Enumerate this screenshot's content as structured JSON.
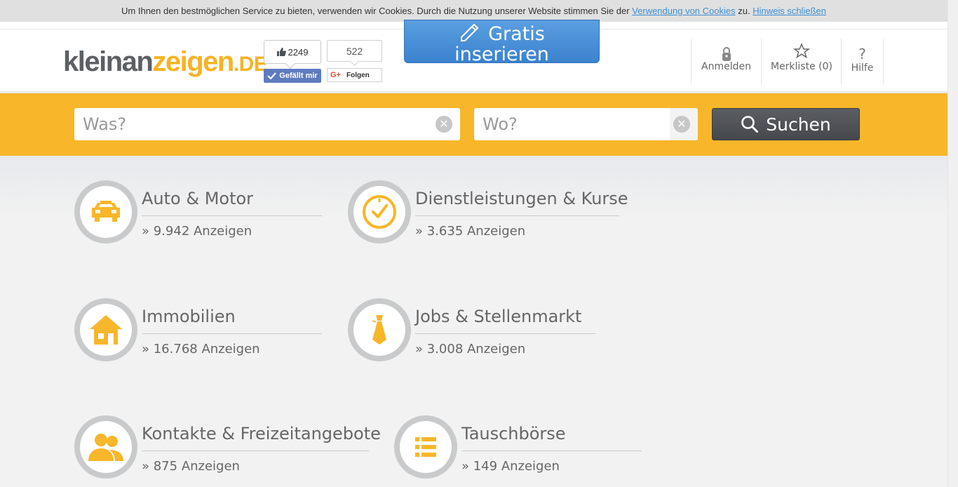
{
  "cookie_bar": {
    "text": "Um Ihnen den bestmöglichen Service zu bieten, verwenden wir Cookies. Durch die Nutzung unserer Website stimmen Sie der",
    "link1": "Verwendung von Cookies",
    "middle": "zu.",
    "link2": "Hinweis schließen"
  },
  "logo": {
    "part1": "kleinan",
    "part2": "zeigen",
    "part3": ".DE"
  },
  "social": {
    "fb_count": "2249",
    "fb_label": "Gefällt mir",
    "gp_count": "522",
    "gp_label": "Folgen",
    "gp_glyph": "G+"
  },
  "post_button": {
    "label_line1": "Gratis",
    "label_line2": "inserieren",
    "icon": "pencil-icon"
  },
  "nav": {
    "login": "Anmelden",
    "merkliste": "Merkliste (0)",
    "help": "Hilfe",
    "help_glyph": "?"
  },
  "search": {
    "was_placeholder": "Was?",
    "wo_placeholder": "Wo?",
    "button_label": "Suchen"
  },
  "categories": [
    {
      "title": "Auto & Motor",
      "count": "» 9.942 Anzeigen",
      "icon": "car-icon"
    },
    {
      "title": "Dienstleistungen & Kurse",
      "count": "» 3.635 Anzeigen",
      "icon": "clock-check-icon"
    },
    {
      "title": "Immobilien",
      "count": "» 16.768 Anzeigen",
      "icon": "house-icon"
    },
    {
      "title": "Jobs & Stellenmarkt",
      "count": "» 3.008 Anzeigen",
      "icon": "tie-icon"
    },
    {
      "title": "Kontakte & Freizeitangebote",
      "count": "» 875 Anzeigen",
      "icon": "people-icon"
    },
    {
      "title": "Tauschbörse",
      "count": "» 149 Anzeigen",
      "icon": "list-icon"
    }
  ],
  "colors": {
    "accent_yellow": "#f8b62a",
    "button_blue": "#4a90d9",
    "dark_button": "#4f5256"
  }
}
